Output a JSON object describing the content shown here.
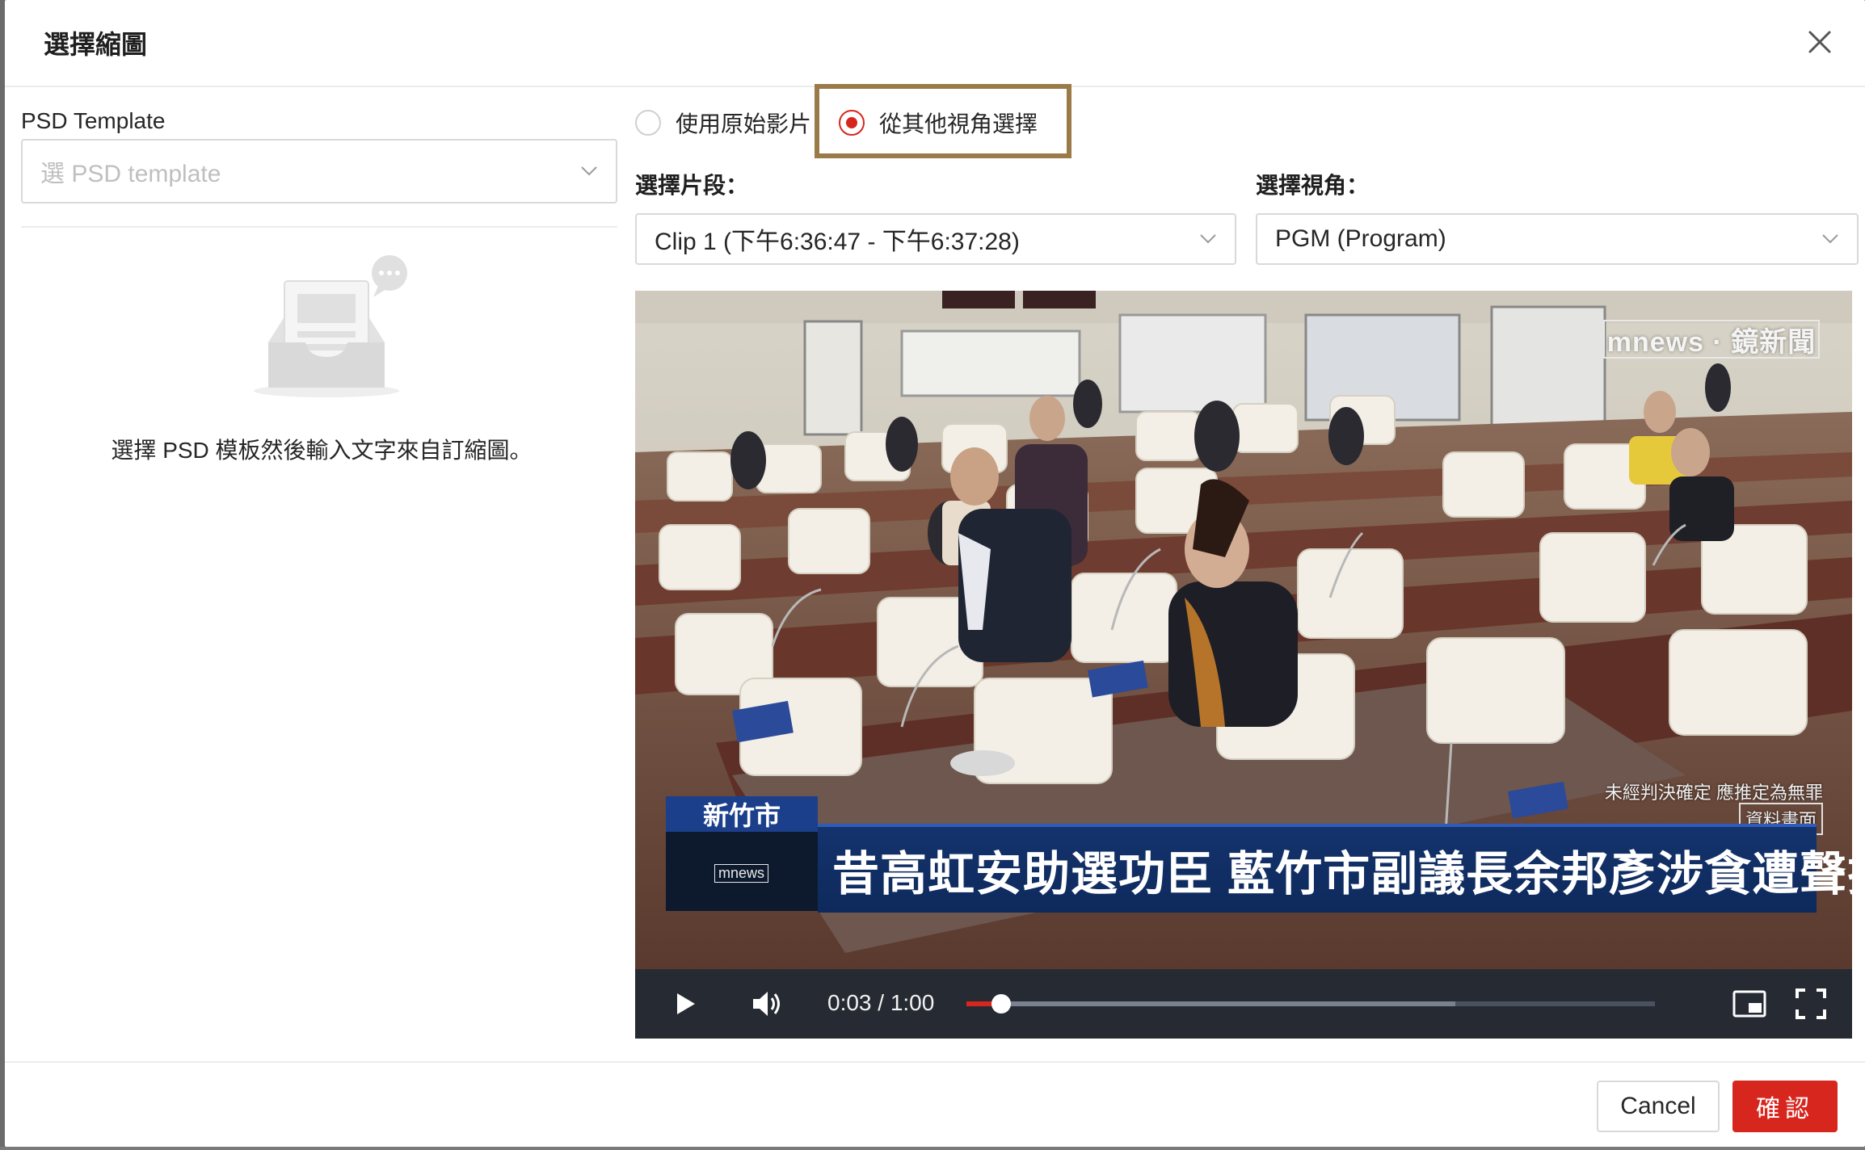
{
  "modal": {
    "title": "選擇縮圖"
  },
  "left": {
    "psd_label": "PSD Template",
    "psd_placeholder": "選 PSD template",
    "empty_text": "選擇 PSD 模板然後輸入文字來自訂縮圖。"
  },
  "right": {
    "radio_options": [
      {
        "label": "使用原始影片",
        "checked": false
      },
      {
        "label": "從其他視角選擇",
        "checked": true
      }
    ],
    "clip_label": "選擇片段：",
    "clip_value": "Clip 1 (下午6:36:47 - 下午6:37:28)",
    "view_label": "選擇視角：",
    "view_value": "PGM (Program)"
  },
  "video": {
    "overlay": {
      "logo": "mnews · 鏡新聞",
      "disclaimer": "未經判決確定 應推定為無罪",
      "archive_tag": "資料畫面",
      "city": "新竹市",
      "thumb_logo": "mnews",
      "headline": "昔高虹安助選功臣 藍竹市副議長余邦彥涉貪遭聲押"
    },
    "time_display": "0:03 / 1:00",
    "progress_played": 0.05,
    "progress_buffered": 0.71
  },
  "footer": {
    "cancel_label": "Cancel",
    "confirm_label": "確認"
  },
  "colors": {
    "accent": "#d7261e",
    "highlight_box": "#9a7a49",
    "player_bar": "#262b33"
  },
  "icons": {
    "close": "close-icon",
    "chevron": "chevron-down-icon",
    "play": "play-icon",
    "volume": "volume-icon",
    "pip": "picture-in-picture-icon",
    "fullscreen": "fullscreen-icon"
  }
}
